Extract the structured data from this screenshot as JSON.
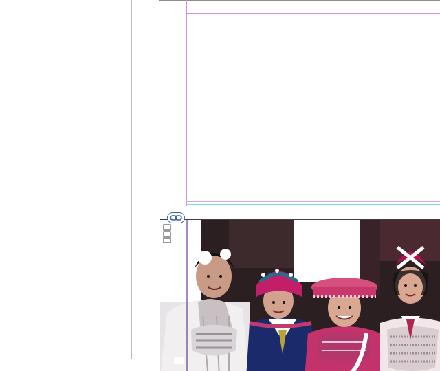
{
  "canvas": {
    "pages": [
      {
        "name": "left-page"
      },
      {
        "name": "right-page"
      }
    ]
  },
  "image_frame": {
    "icon": "link-icon",
    "content": "group-photo"
  },
  "colors": {
    "guide_magenta": "#d88fd8",
    "frame_cyan": "#7fd6ef",
    "link_badge_blue": "#3b5fb0",
    "page_border": "#b9b9b9"
  }
}
